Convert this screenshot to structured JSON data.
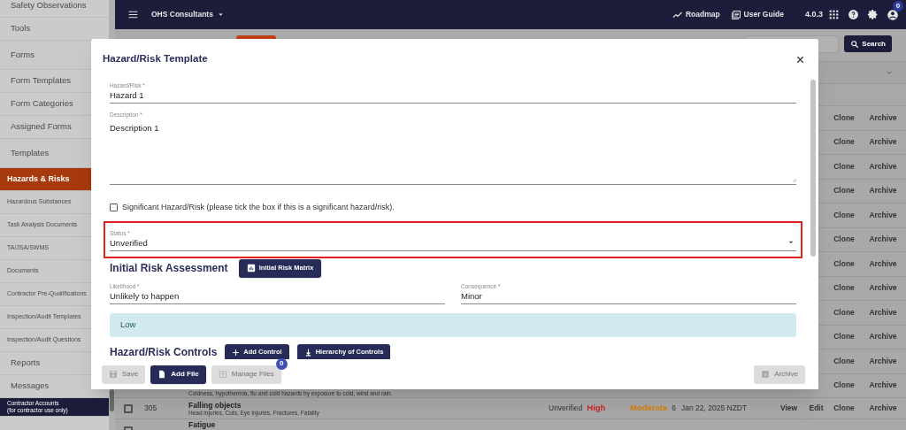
{
  "sidebar": {
    "items": [
      {
        "label": "Safety Observations",
        "kind": "main",
        "selected": false
      },
      {
        "label": "Tools",
        "kind": "main",
        "selected": false
      },
      {
        "label": "Forms",
        "kind": "group",
        "selected": false
      },
      {
        "label": "Form Templates",
        "kind": "main",
        "selected": false
      },
      {
        "label": "Form Categories",
        "kind": "main",
        "selected": false
      },
      {
        "label": "Assigned Forms",
        "kind": "main",
        "selected": false
      },
      {
        "label": "Templates",
        "kind": "group",
        "selected": false
      },
      {
        "label": "Hazards & Risks",
        "kind": "sub",
        "selected": true
      },
      {
        "label": "Hazardous Substances",
        "kind": "sub",
        "selected": false
      },
      {
        "label": "Task Analysis Documents",
        "kind": "sub",
        "selected": false
      },
      {
        "label": "TA/JSA/SWMS",
        "kind": "sub",
        "selected": false
      },
      {
        "label": "Documents",
        "kind": "sub",
        "selected": false
      },
      {
        "label": "Contractor Pre-Qualifications",
        "kind": "sub",
        "selected": false
      },
      {
        "label": "Inspection/Audit Templates",
        "kind": "sub",
        "selected": false
      },
      {
        "label": "Inspection/Audit Questions",
        "kind": "sub",
        "selected": false
      },
      {
        "label": "Reports",
        "kind": "main",
        "selected": false
      },
      {
        "label": "Messages",
        "kind": "main",
        "selected": false
      },
      {
        "label": "Contractor Accounts\n(for contractor use only)",
        "kind": "callout",
        "selected": false
      }
    ]
  },
  "topbar": {
    "company": "OHS Consultants",
    "links": [
      "Roadmap",
      "User Guide"
    ],
    "version": "4.0.3",
    "notification_count": "0"
  },
  "toolbar": {
    "search_button": "Search"
  },
  "table": {
    "rows": [
      {
        "actions": [
          "Clone",
          "Archive"
        ]
      },
      {
        "actions": [
          "Clone",
          "Archive"
        ]
      },
      {
        "actions": [
          "Clone",
          "Archive"
        ]
      },
      {
        "actions": [
          "Clone",
          "Archive"
        ]
      },
      {
        "actions": [
          "Clone",
          "Archive"
        ]
      },
      {
        "actions": [
          "Clone",
          "Archive"
        ]
      },
      {
        "actions": [
          "Clone",
          "Archive"
        ]
      },
      {
        "actions": [
          "Clone",
          "Archive"
        ]
      },
      {
        "actions": [
          "Clone",
          "Archive"
        ]
      },
      {
        "actions": [
          "Clone",
          "Archive"
        ]
      },
      {
        "actions": [
          "Clone",
          "Archive"
        ]
      },
      {
        "subtitle": "Coldness, hypothermia, flu and cold hazards by exposure to cold, wind and rain.",
        "actions": [
          "Clone",
          "Archive"
        ]
      },
      {
        "checked": false,
        "number": "305",
        "title": "Falling objects",
        "subtitle": "Head injuries, Cuts, Eye injuries, Fractures, Fatality",
        "status": "Unverified",
        "risk": {
          "label": "High",
          "color": "#c62828"
        },
        "residual": {
          "label": "Moderate",
          "color": "#d97d0a"
        },
        "score": "6",
        "date": "Jan 22, 2025 NZDT",
        "actions": [
          "View",
          "Edit",
          "Clone",
          "Archive"
        ]
      },
      {
        "checked": false,
        "title": "Fatigue"
      }
    ]
  },
  "modal": {
    "title": "Hazard/Risk Template",
    "hazard_field": {
      "label": "Hazard/Risk *",
      "value": "Hazard 1"
    },
    "description_field": {
      "label": "Description *",
      "value": "Description 1"
    },
    "significant_checkbox": {
      "label": "Significant Hazard/Risk (please tick the box if this is a significant hazard/risk).",
      "checked": false
    },
    "status_field": {
      "label": "Status *",
      "value": "Unverified",
      "highlighted": true
    },
    "initial_risk": {
      "heading": "Initial Risk Assessment",
      "matrix_button": "Initial Risk Matrix",
      "likelihood": {
        "label": "Likelihood *",
        "value": "Unlikely to happen"
      },
      "consequence": {
        "label": "Consequence *",
        "value": "Minor"
      },
      "rating": "Low"
    },
    "controls": {
      "heading": "Hazard/Risk Controls",
      "buttons": [
        "Add Control",
        "Hierarchy of Controls"
      ]
    },
    "footer": {
      "buttons": [
        {
          "label": "Save",
          "disabled": true
        },
        {
          "label": "Add File",
          "disabled": false
        },
        {
          "label": "Manage Files",
          "disabled": true,
          "badge": "0"
        },
        {
          "label": "Archive",
          "disabled": true
        }
      ]
    }
  }
}
